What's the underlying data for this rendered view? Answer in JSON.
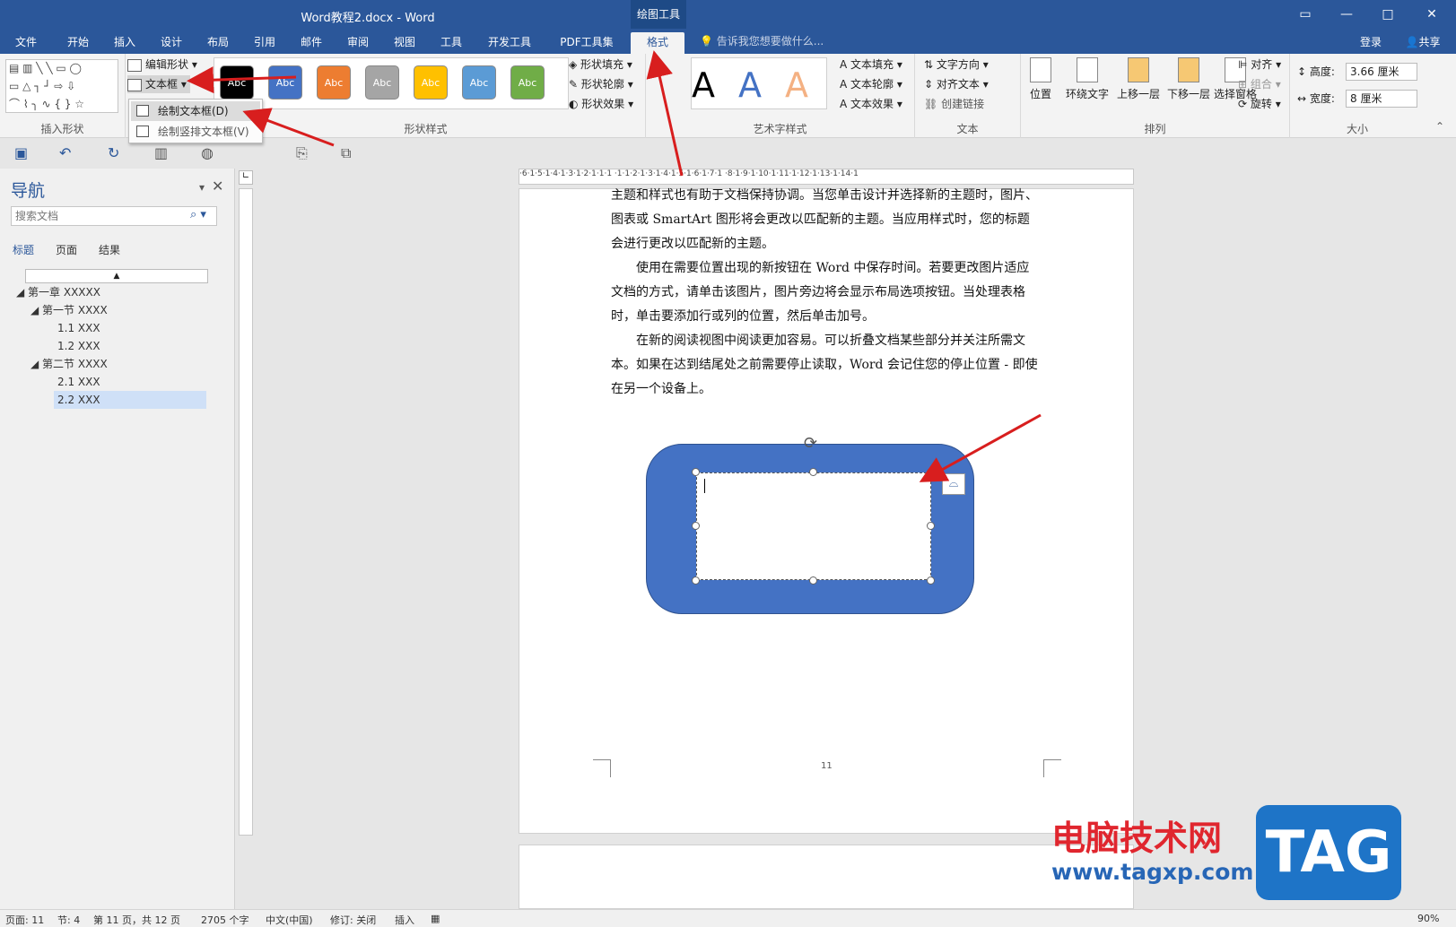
{
  "window": {
    "title": "Word教程2.docx - Word",
    "context_tab": "绘图工具",
    "controls": [
      "▭",
      "—",
      "□",
      "✕"
    ]
  },
  "tabs": [
    "文件",
    "开始",
    "插入",
    "设计",
    "布局",
    "引用",
    "邮件",
    "审阅",
    "视图",
    "工具",
    "开发工具",
    "PDF工具集",
    "格式"
  ],
  "active_tab": "格式",
  "tell_me": "告诉我您想要做什么...",
  "account": {
    "login": "登录",
    "share": "共享"
  },
  "ribbon": {
    "insert_shapes": {
      "label": "插入形状",
      "edit_shape": "编辑形状",
      "textbox": "文本框"
    },
    "shape_styles": {
      "label": "形状样式",
      "sample": "Abc",
      "colors": [
        "#000000",
        "#4472c4",
        "#ed7d31",
        "#a5a5a5",
        "#ffc000",
        "#5b9bd5",
        "#70ad47"
      ],
      "fill": "形状填充",
      "outline": "形状轮廓",
      "effect": "形状效果"
    },
    "wordart": {
      "label": "艺术字样式",
      "glyph": "A",
      "fill": "文本填充",
      "outline": "文本轮廓",
      "effect": "文本效果"
    },
    "text": {
      "label": "文本",
      "direction": "文字方向",
      "align": "对齐文本",
      "link": "创建链接"
    },
    "arrange": {
      "label": "排列",
      "position": "位置",
      "wrap": "环绕文字",
      "forward": "上移一层",
      "backward": "下移一层",
      "pane": "选择窗格",
      "align": "对齐",
      "group": "组合",
      "rotate": "旋转"
    },
    "size": {
      "label": "大小",
      "height_label": "高度:",
      "height": "3.66 厘米",
      "width_label": "宽度:",
      "width": "8 厘米"
    }
  },
  "dropdown": {
    "draw_textbox": "绘制文本框(D)",
    "draw_vertical": "绘制竖排文本框(V)"
  },
  "nav": {
    "title": "导航",
    "search_placeholder": "搜索文档",
    "tabs": [
      "标题",
      "页面",
      "结果"
    ],
    "tree": [
      "第一章 XXXXX",
      "第一节 XXXX",
      "1.1 XXX",
      "1.2 XXX",
      "第二节 XXXX",
      "2.1 XXX",
      "2.2 XXX"
    ]
  },
  "document": {
    "paragraphs": [
      "主题和样式也有助于文档保持协调。当您单击设计并选择新的主题时，图片、图表或 SmartArt 图形将会更改以匹配新的主题。当应用样式时，您的标题会进行更改以匹配新的主题。",
      "使用在需要位置出现的新按钮在 Word 中保存时间。若要更改图片适应文档的方式，请单击该图片，图片旁边将会显示布局选项按钮。当处理表格时，单击要添加行或列的位置，然后单击加号。",
      "在新的阅读视图中阅读更加容易。可以折叠文档某些部分并关注所需文本。如果在达到结尾处之前需要停止读取，Word 会记住您的停止位置 - 即使在另一个设备上。"
    ],
    "page_number": "11",
    "shape_color": "#4472c4"
  },
  "ruler": "·6·1·5·1·4·1·3·1·2·1·1·1  ·1·1·2·1·3·1·4·1·5·1·6·1·7·1  ·8·1·9·1·10·1·11·1·12·1·13·1·14·1",
  "status": {
    "page": "页面: 11",
    "section": "节: 4",
    "page_of": "第 11 页，共 12 页",
    "words": "2705 个字",
    "lang": "中文(中国)",
    "track": "修订: 关闭",
    "mode": "插入",
    "zoom": "90%"
  },
  "watermark": {
    "site": "电脑技术网",
    "url": "www.tagxp.com",
    "tag": "TAG"
  }
}
